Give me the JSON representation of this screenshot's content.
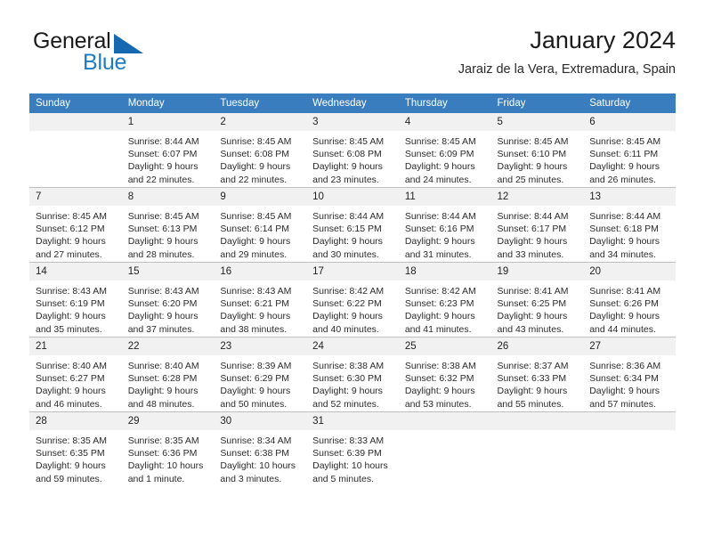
{
  "brand": {
    "name_part1": "General",
    "name_part2": "Blue",
    "accent_color": "#1d7dc4",
    "triangle_color": "#1669b0"
  },
  "header": {
    "title": "January 2024",
    "subtitle": "Jaraiz de la Vera, Extremadura, Spain"
  },
  "calendar": {
    "header_bg": "#3a7dbf",
    "daynum_bg": "#f1f1f1",
    "weekday_headers": [
      "Sunday",
      "Monday",
      "Tuesday",
      "Wednesday",
      "Thursday",
      "Friday",
      "Saturday"
    ],
    "weeks": [
      [
        {
          "day": "",
          "sunrise": "",
          "sunset": "",
          "daylight1": "",
          "daylight2": "",
          "empty": true
        },
        {
          "day": "1",
          "sunrise": "Sunrise: 8:44 AM",
          "sunset": "Sunset: 6:07 PM",
          "daylight1": "Daylight: 9 hours",
          "daylight2": "and 22 minutes."
        },
        {
          "day": "2",
          "sunrise": "Sunrise: 8:45 AM",
          "sunset": "Sunset: 6:08 PM",
          "daylight1": "Daylight: 9 hours",
          "daylight2": "and 22 minutes."
        },
        {
          "day": "3",
          "sunrise": "Sunrise: 8:45 AM",
          "sunset": "Sunset: 6:08 PM",
          "daylight1": "Daylight: 9 hours",
          "daylight2": "and 23 minutes."
        },
        {
          "day": "4",
          "sunrise": "Sunrise: 8:45 AM",
          "sunset": "Sunset: 6:09 PM",
          "daylight1": "Daylight: 9 hours",
          "daylight2": "and 24 minutes."
        },
        {
          "day": "5",
          "sunrise": "Sunrise: 8:45 AM",
          "sunset": "Sunset: 6:10 PM",
          "daylight1": "Daylight: 9 hours",
          "daylight2": "and 25 minutes."
        },
        {
          "day": "6",
          "sunrise": "Sunrise: 8:45 AM",
          "sunset": "Sunset: 6:11 PM",
          "daylight1": "Daylight: 9 hours",
          "daylight2": "and 26 minutes."
        }
      ],
      [
        {
          "day": "7",
          "sunrise": "Sunrise: 8:45 AM",
          "sunset": "Sunset: 6:12 PM",
          "daylight1": "Daylight: 9 hours",
          "daylight2": "and 27 minutes."
        },
        {
          "day": "8",
          "sunrise": "Sunrise: 8:45 AM",
          "sunset": "Sunset: 6:13 PM",
          "daylight1": "Daylight: 9 hours",
          "daylight2": "and 28 minutes."
        },
        {
          "day": "9",
          "sunrise": "Sunrise: 8:45 AM",
          "sunset": "Sunset: 6:14 PM",
          "daylight1": "Daylight: 9 hours",
          "daylight2": "and 29 minutes."
        },
        {
          "day": "10",
          "sunrise": "Sunrise: 8:44 AM",
          "sunset": "Sunset: 6:15 PM",
          "daylight1": "Daylight: 9 hours",
          "daylight2": "and 30 minutes."
        },
        {
          "day": "11",
          "sunrise": "Sunrise: 8:44 AM",
          "sunset": "Sunset: 6:16 PM",
          "daylight1": "Daylight: 9 hours",
          "daylight2": "and 31 minutes."
        },
        {
          "day": "12",
          "sunrise": "Sunrise: 8:44 AM",
          "sunset": "Sunset: 6:17 PM",
          "daylight1": "Daylight: 9 hours",
          "daylight2": "and 33 minutes."
        },
        {
          "day": "13",
          "sunrise": "Sunrise: 8:44 AM",
          "sunset": "Sunset: 6:18 PM",
          "daylight1": "Daylight: 9 hours",
          "daylight2": "and 34 minutes."
        }
      ],
      [
        {
          "day": "14",
          "sunrise": "Sunrise: 8:43 AM",
          "sunset": "Sunset: 6:19 PM",
          "daylight1": "Daylight: 9 hours",
          "daylight2": "and 35 minutes."
        },
        {
          "day": "15",
          "sunrise": "Sunrise: 8:43 AM",
          "sunset": "Sunset: 6:20 PM",
          "daylight1": "Daylight: 9 hours",
          "daylight2": "and 37 minutes."
        },
        {
          "day": "16",
          "sunrise": "Sunrise: 8:43 AM",
          "sunset": "Sunset: 6:21 PM",
          "daylight1": "Daylight: 9 hours",
          "daylight2": "and 38 minutes."
        },
        {
          "day": "17",
          "sunrise": "Sunrise: 8:42 AM",
          "sunset": "Sunset: 6:22 PM",
          "daylight1": "Daylight: 9 hours",
          "daylight2": "and 40 minutes."
        },
        {
          "day": "18",
          "sunrise": "Sunrise: 8:42 AM",
          "sunset": "Sunset: 6:23 PM",
          "daylight1": "Daylight: 9 hours",
          "daylight2": "and 41 minutes."
        },
        {
          "day": "19",
          "sunrise": "Sunrise: 8:41 AM",
          "sunset": "Sunset: 6:25 PM",
          "daylight1": "Daylight: 9 hours",
          "daylight2": "and 43 minutes."
        },
        {
          "day": "20",
          "sunrise": "Sunrise: 8:41 AM",
          "sunset": "Sunset: 6:26 PM",
          "daylight1": "Daylight: 9 hours",
          "daylight2": "and 44 minutes."
        }
      ],
      [
        {
          "day": "21",
          "sunrise": "Sunrise: 8:40 AM",
          "sunset": "Sunset: 6:27 PM",
          "daylight1": "Daylight: 9 hours",
          "daylight2": "and 46 minutes."
        },
        {
          "day": "22",
          "sunrise": "Sunrise: 8:40 AM",
          "sunset": "Sunset: 6:28 PM",
          "daylight1": "Daylight: 9 hours",
          "daylight2": "and 48 minutes."
        },
        {
          "day": "23",
          "sunrise": "Sunrise: 8:39 AM",
          "sunset": "Sunset: 6:29 PM",
          "daylight1": "Daylight: 9 hours",
          "daylight2": "and 50 minutes."
        },
        {
          "day": "24",
          "sunrise": "Sunrise: 8:38 AM",
          "sunset": "Sunset: 6:30 PM",
          "daylight1": "Daylight: 9 hours",
          "daylight2": "and 52 minutes."
        },
        {
          "day": "25",
          "sunrise": "Sunrise: 8:38 AM",
          "sunset": "Sunset: 6:32 PM",
          "daylight1": "Daylight: 9 hours",
          "daylight2": "and 53 minutes."
        },
        {
          "day": "26",
          "sunrise": "Sunrise: 8:37 AM",
          "sunset": "Sunset: 6:33 PM",
          "daylight1": "Daylight: 9 hours",
          "daylight2": "and 55 minutes."
        },
        {
          "day": "27",
          "sunrise": "Sunrise: 8:36 AM",
          "sunset": "Sunset: 6:34 PM",
          "daylight1": "Daylight: 9 hours",
          "daylight2": "and 57 minutes."
        }
      ],
      [
        {
          "day": "28",
          "sunrise": "Sunrise: 8:35 AM",
          "sunset": "Sunset: 6:35 PM",
          "daylight1": "Daylight: 9 hours",
          "daylight2": "and 59 minutes."
        },
        {
          "day": "29",
          "sunrise": "Sunrise: 8:35 AM",
          "sunset": "Sunset: 6:36 PM",
          "daylight1": "Daylight: 10 hours",
          "daylight2": "and 1 minute."
        },
        {
          "day": "30",
          "sunrise": "Sunrise: 8:34 AM",
          "sunset": "Sunset: 6:38 PM",
          "daylight1": "Daylight: 10 hours",
          "daylight2": "and 3 minutes."
        },
        {
          "day": "31",
          "sunrise": "Sunrise: 8:33 AM",
          "sunset": "Sunset: 6:39 PM",
          "daylight1": "Daylight: 10 hours",
          "daylight2": "and 5 minutes."
        },
        {
          "day": "",
          "sunrise": "",
          "sunset": "",
          "daylight1": "",
          "daylight2": "",
          "empty": true
        },
        {
          "day": "",
          "sunrise": "",
          "sunset": "",
          "daylight1": "",
          "daylight2": "",
          "empty": true
        },
        {
          "day": "",
          "sunrise": "",
          "sunset": "",
          "daylight1": "",
          "daylight2": "",
          "empty": true
        }
      ]
    ]
  }
}
